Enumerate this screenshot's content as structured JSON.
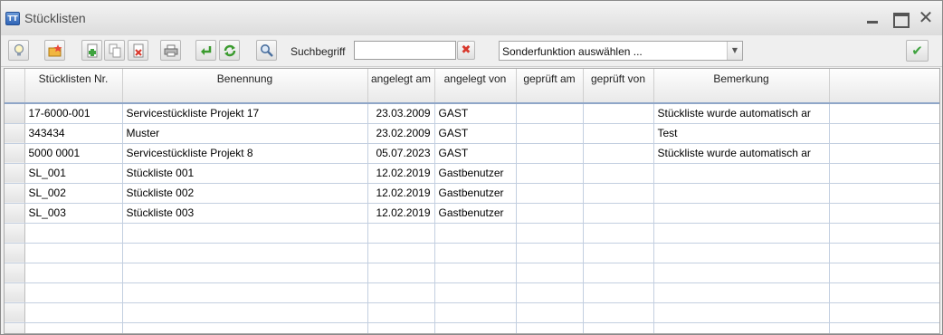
{
  "window": {
    "title": "Stücklisten",
    "app_icon_text": "TT"
  },
  "toolbar": {
    "search_label": "Suchbegriff",
    "search_value": "",
    "select_value": "Sonderfunktion auswählen ...",
    "buttons": [
      "lightbulb-icon",
      "folder-star-icon",
      "new-document-icon",
      "copy-document-icon",
      "delete-document-icon",
      "print-icon",
      "undo-icon",
      "refresh-icon",
      "search-icon",
      "clear-icon",
      "confirm-icon"
    ]
  },
  "table": {
    "headers": [
      "Stücklisten Nr.",
      "Benennung",
      "angelegt am",
      "angelegt von",
      "geprüft am",
      "geprüft von",
      "Bemerkung"
    ],
    "rows": [
      [
        "17-6000-001",
        "Servicestückliste Projekt 17",
        "23.03.2009",
        "GAST",
        "",
        "",
        "Stückliste wurde automatisch ar"
      ],
      [
        "343434",
        "Muster",
        "23.02.2009",
        "GAST",
        "",
        "",
        "Test"
      ],
      [
        "5000 0001",
        "Servicestückliste Projekt 8",
        "05.07.2023",
        "GAST",
        "",
        "",
        "Stückliste wurde automatisch ar"
      ],
      [
        "SL_001",
        "Stückliste 001",
        "12.02.2019",
        "Gastbenutzer",
        "",
        "",
        ""
      ],
      [
        "SL_002",
        "Stückliste 002",
        "12.02.2019",
        "Gastbenutzer",
        "",
        "",
        ""
      ],
      [
        "SL_003",
        "Stückliste 003",
        "12.02.2019",
        "Gastbenutzer",
        "",
        "",
        ""
      ]
    ],
    "empty_rows": 6
  },
  "colors": {
    "grid_line": "#c3cfe0",
    "header_border": "#8fa6c8",
    "accent_green": "#3fa33f",
    "accent_red": "#d8382c"
  }
}
